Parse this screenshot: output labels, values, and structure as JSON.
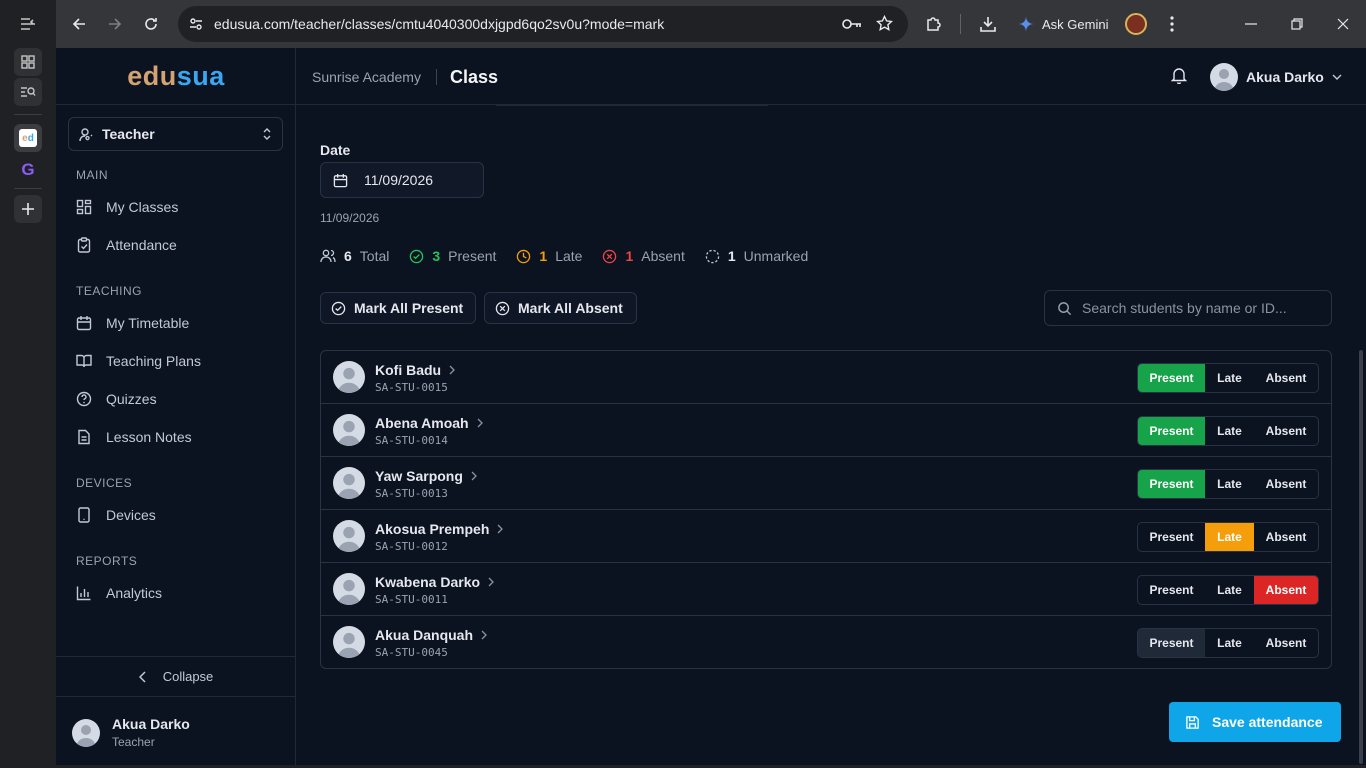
{
  "browser": {
    "url": "edusua.com/teacher/classes/cmtu4040300dxjgpd6qo2sv0u?mode=mark",
    "gemini_label": "Ask Gemini"
  },
  "sidebar": {
    "logo_a": "edu",
    "logo_b": "sua",
    "role": "Teacher",
    "sections": {
      "main": "MAIN",
      "teaching": "TEACHING",
      "devices": "DEVICES",
      "reports": "REPORTS"
    },
    "items": {
      "my_classes": "My Classes",
      "attendance": "Attendance",
      "my_timetable": "My Timetable",
      "teaching_plans": "Teaching Plans",
      "quizzes": "Quizzes",
      "lesson_notes": "Lesson Notes",
      "devices": "Devices",
      "analytics": "Analytics"
    },
    "collapse": "Collapse",
    "user_name": "Akua Darko",
    "user_role": "Teacher"
  },
  "header": {
    "school": "Sunrise Academy",
    "page": "Class",
    "user_name": "Akua Darko"
  },
  "attendance": {
    "date_label": "Date",
    "date_value": "11/09/2026",
    "date_sub": "11/09/2026",
    "stats": {
      "total": "6",
      "total_label": "Total",
      "present": "3",
      "present_label": "Present",
      "late": "1",
      "late_label": "Late",
      "absent": "1",
      "absent_label": "Absent",
      "unmarked": "1",
      "unmarked_label": "Unmarked"
    },
    "mark_all_present": "Mark All Present",
    "mark_all_absent": "Mark All Absent",
    "search_placeholder": "Search students by name or ID...",
    "option_present": "Present",
    "option_late": "Late",
    "option_absent": "Absent",
    "students": [
      {
        "name": "Kofi Badu",
        "id": "SA-STU-0015",
        "status": "present"
      },
      {
        "name": "Abena Amoah",
        "id": "SA-STU-0014",
        "status": "present"
      },
      {
        "name": "Yaw Sarpong",
        "id": "SA-STU-0013",
        "status": "present"
      },
      {
        "name": "Akosua Prempeh",
        "id": "SA-STU-0012",
        "status": "late"
      },
      {
        "name": "Kwabena Darko",
        "id": "SA-STU-0011",
        "status": "absent"
      },
      {
        "name": "Akua Danquah",
        "id": "SA-STU-0045",
        "status": "none"
      }
    ],
    "save": "Save attendance"
  },
  "colors": {
    "present": "#16a34a",
    "late": "#f59e0b",
    "absent": "#dc2626",
    "primary": "#0ea5e9"
  }
}
